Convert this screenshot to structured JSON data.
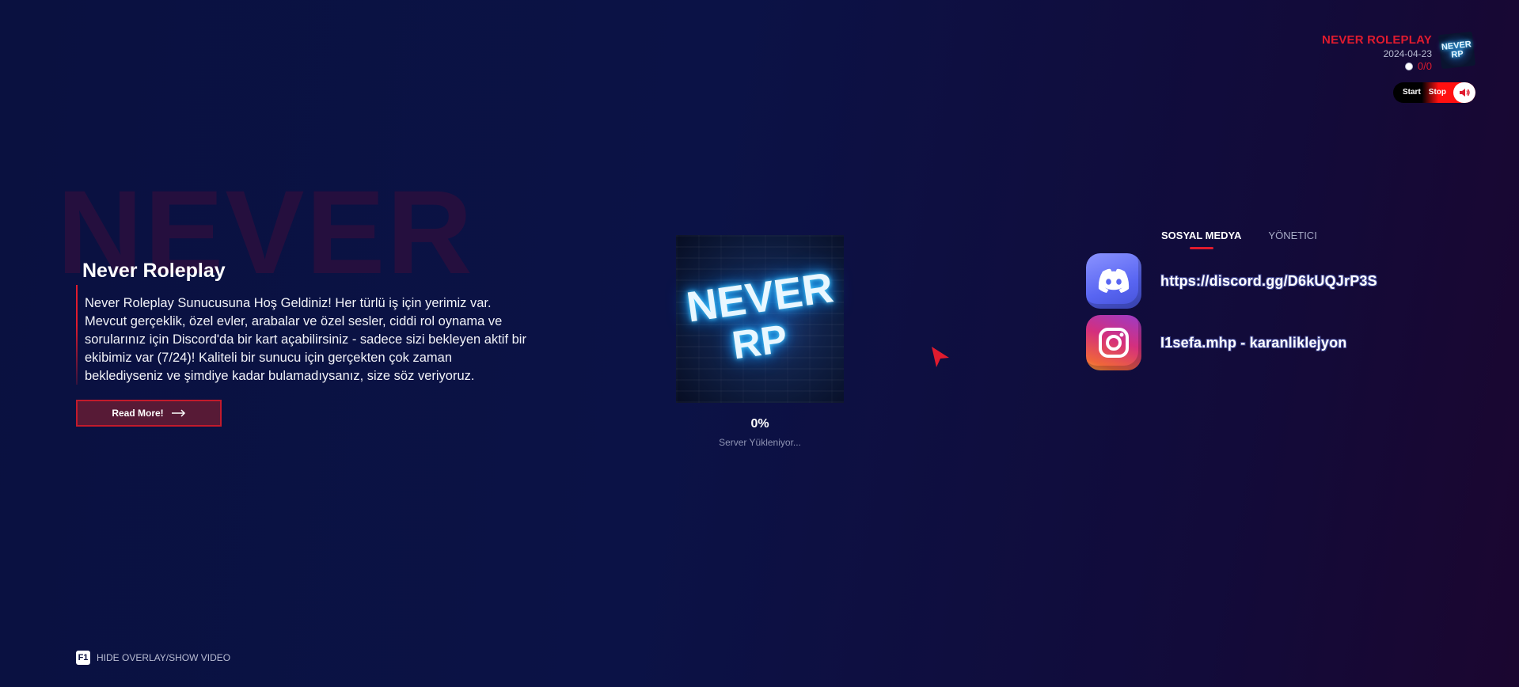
{
  "server": {
    "name": "NEVER ROLEPLAY",
    "date": "2024-04-23",
    "players": "0/0",
    "logo_line1": "NEVER",
    "logo_line2": "RP"
  },
  "music": {
    "start_label": "Start",
    "stop_label": "Stop",
    "volume_icon": "volume-icon"
  },
  "hero": {
    "background_word": "NEVER",
    "title": "Never Roleplay",
    "description": "Never Roleplay Sunucusuna Hoş Geldiniz! Her türlü iş için yerimiz var. Mevcut gerçeklik, özel evler, arabalar ve özel sesler, ciddi rol oynama ve sorularınız için Discord'da bir kart açabilirsiniz - sadece sizi bekleyen aktif bir ekibimiz var (7/24)! Kaliteli bir sunucu için gerçekten çok zaman beklediyseniz ve şimdiye kadar bulamadıysanız, size söz veriyoruz.",
    "read_more_label": "Read More!"
  },
  "loader": {
    "logo_line1": "NEVER",
    "logo_line2": "RP",
    "progress": "0%",
    "status": "Server Yükleniyor..."
  },
  "social": {
    "tabs": [
      {
        "label": "SOSYAL MEDYA",
        "active": true
      },
      {
        "label": "YÖNETICI",
        "active": false
      }
    ],
    "items": [
      {
        "icon": "discord-icon",
        "text": "https://discord.gg/D6kUQJrP3S"
      },
      {
        "icon": "instagram-icon",
        "text": "I1sefa.mhp - karanliklejyon"
      }
    ]
  },
  "footer": {
    "key": "F1",
    "hint": "HIDE OVERLAY/SHOW VIDEO"
  },
  "colors": {
    "accent": "#e01b2e",
    "background": "#0a1140",
    "discord": "#5865f2"
  }
}
